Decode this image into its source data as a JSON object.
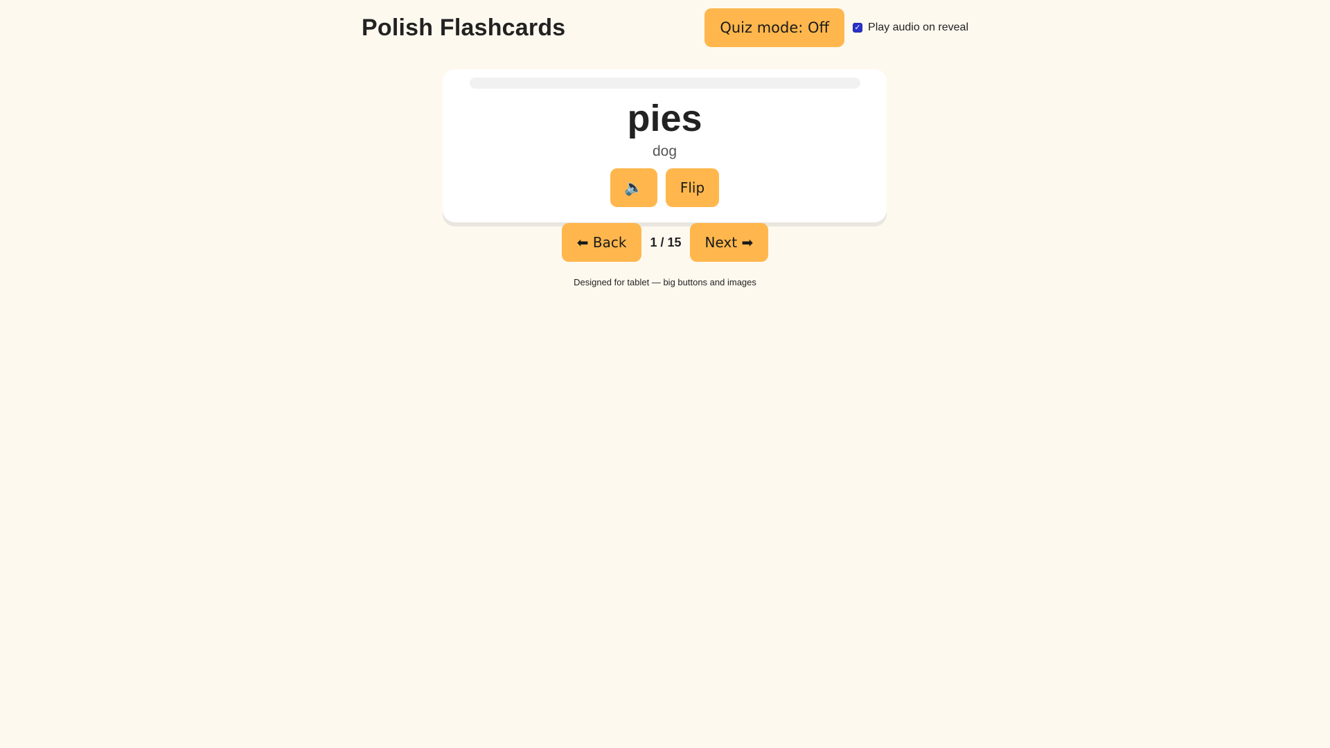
{
  "header": {
    "title": "Polish Flashcards",
    "quiz_mode_label": "Quiz mode: Off",
    "audio_toggle": {
      "label": "Play audio on reveal",
      "checked": true
    }
  },
  "card": {
    "progress": 0,
    "word": "pies",
    "translation": "dog",
    "speaker_label": "🔈",
    "flip_label": "Flip"
  },
  "nav": {
    "back_label": "⬅ Back",
    "counter": "1 / 15",
    "next_label": "Next ➡"
  },
  "footer": {
    "note": "Designed for tablet — big buttons and images"
  },
  "colors": {
    "background": "#fef9ef",
    "accent": "#ffb74d",
    "card": "#ffffff",
    "checkbox": "#2b31c9"
  },
  "icons": {
    "speaker": "speaker-icon",
    "checkbox": "checkmark-icon"
  }
}
